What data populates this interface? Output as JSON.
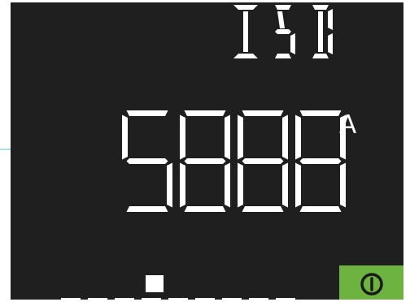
{
  "display": {
    "mode_indicator": "ISD",
    "value": "5888",
    "unit": "A"
  },
  "status_bar": {
    "segments_visible": 9,
    "marker": "square-marker"
  },
  "power_button": {
    "icon": "power-icon",
    "color": "#6db33f"
  },
  "colors": {
    "screen_background": "#1f1f1f",
    "segment": "#ffffff",
    "accent": "#6db33f",
    "edge_line": "#5bbbe0"
  }
}
